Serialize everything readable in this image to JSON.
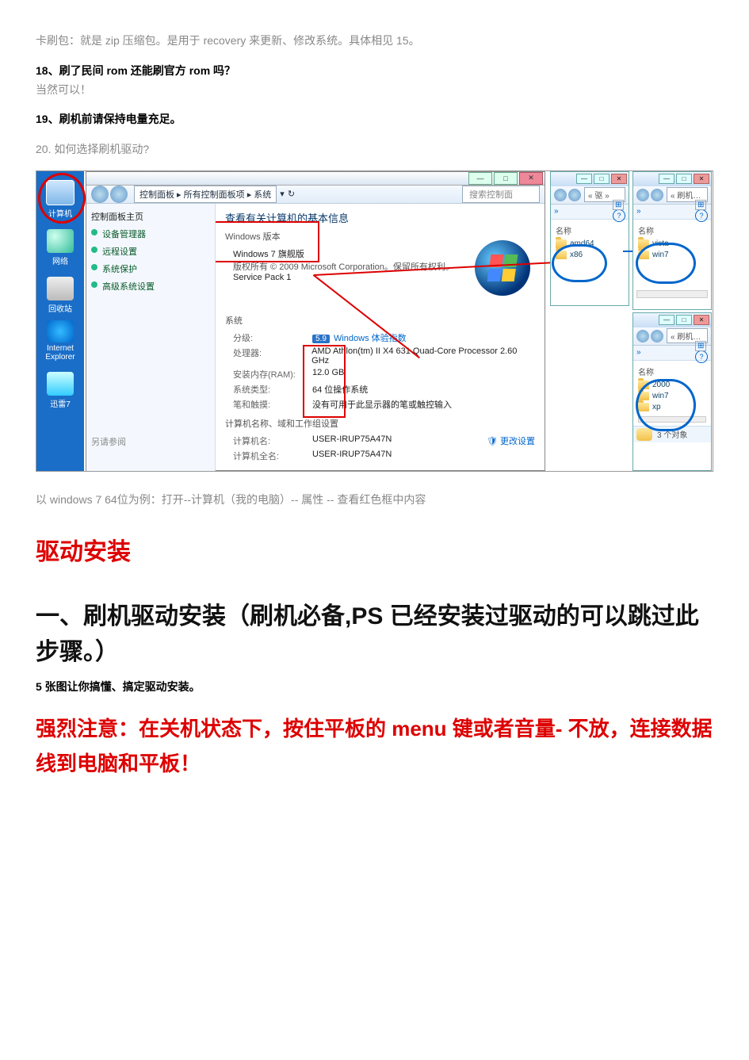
{
  "doc": {
    "p1": "卡刷包：就是 zip 压缩包。是用于 recovery 来更新、修改系统。具体相见 15。",
    "q18": "18、刷了民间 rom 还能刷官方 rom 吗？",
    "a18": "当然可以！",
    "q19": "19、刷机前请保持电量充足。",
    "q20": "20. 如何选择刷机驱动?",
    "caption": "以 windows 7 64位为例：打开--计算机（我的电脑）-- 属性 -- 查看红色框中内容",
    "h_driver": "驱动安装",
    "h_section1": "一、刷机驱动安装（刷机必备,PS 已经安装过驱动的可以跳过此步骤。）",
    "p_5pics": "5 张图让你搞懂、搞定驱动安装。",
    "warn": "强烈注意：在关机状态下，按住平板的 menu 键或者音量- 不放，连接数据线到电脑和平板！"
  },
  "desktop": {
    "computer": "计算机",
    "network": "网络",
    "recycle": "回收站",
    "ie1": "Internet",
    "ie2": "Explorer",
    "xunlei": "迅雷7"
  },
  "win": {
    "breadcrumb": [
      "控制面板",
      "所有控制面板项",
      "系统"
    ],
    "search": "搜索控制面",
    "sidebar": {
      "home": "控制面板主页",
      "links": [
        "设备管理器",
        "远程设置",
        "系统保护",
        "高级系统设置"
      ],
      "footer": "另请参阅"
    },
    "title": "查看有关计算机的基本信息",
    "edition_hdr": "Windows 版本",
    "edition": "Windows 7 旗舰版",
    "copyright": "版权所有 © 2009 Microsoft Corporation。保留所有权利。",
    "sp": "Service Pack 1",
    "sys_hdr": "系统",
    "rows": {
      "rating_k": "分级:",
      "rating_badge": "5.9",
      "rating_v": "Windows 体验指数",
      "cpu_k": "处理器:",
      "cpu_v": "AMD Athlon(tm) II X4 631 Quad-Core Processor   2.60 GHz",
      "ram_k": "安装内存(RAM):",
      "ram_v": "12.0 GB",
      "type_k": "系统类型:",
      "type_v": "64 位操作系统",
      "pen_k": "笔和触摸:",
      "pen_v": "没有可用于此显示器的笔或触控输入"
    },
    "name_hdr": "计算机名称、域和工作组设置",
    "name_k": "计算机名:",
    "name_v": "USER-IRUP75A47N",
    "full_k": "计算机全名:",
    "full_v": "USER-IRUP75A47N",
    "change": "更改设置"
  },
  "ex1": {
    "path": "« 驱  »",
    "menu": "»",
    "hd": "名称",
    "items": [
      "amd64",
      "x86"
    ]
  },
  "ex2": {
    "path": "« 刷机…",
    "menu": "»",
    "hd": "名称",
    "items": [
      "vista",
      "win7"
    ]
  },
  "ex3": {
    "path": "« 刷机…",
    "menu": "»",
    "hd": "名称",
    "items": [
      "2000",
      "win7",
      "xp"
    ],
    "status": "3 个对象"
  }
}
